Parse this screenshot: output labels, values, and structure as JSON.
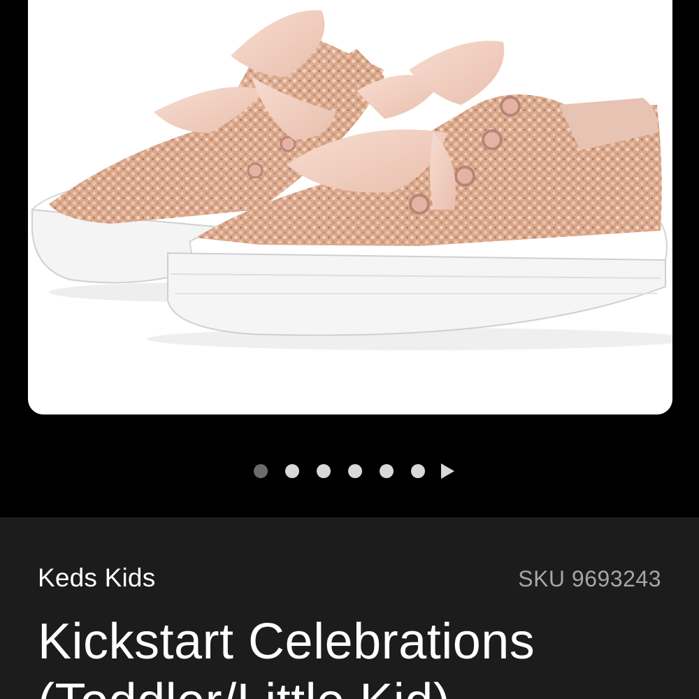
{
  "product": {
    "brand": "Keds Kids",
    "sku": "SKU 9693243",
    "title": "Kickstart Celebrations (Toddler/Little Kid)"
  },
  "gallery": {
    "image_subject": "rose-gold-glitter-sneakers",
    "dot_count": 6,
    "active_index": 0
  },
  "colors": {
    "background": "#000000",
    "panel": "#1c1c1d",
    "dot_active": "#6b6b6b",
    "dot_inactive": "#d8d8d8",
    "sku_text": "#a6a6a6"
  }
}
